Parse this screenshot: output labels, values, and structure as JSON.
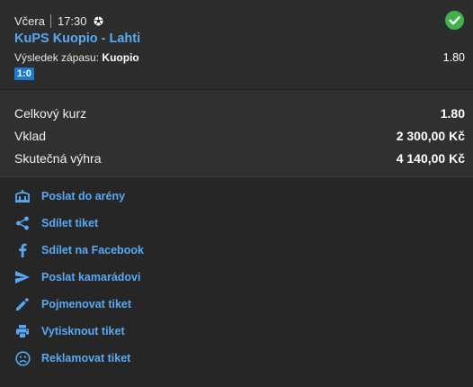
{
  "bet": {
    "day": "Včera",
    "time": "17:30",
    "sport_icon": "soccer-ball-icon",
    "status_icon": "check-circle-icon",
    "match": "KuPS Kuopio - Lahti",
    "market_label": "Výsledek zápasu:",
    "selection": "Kuopio",
    "odd": "1.80",
    "score": "1:0"
  },
  "summary": {
    "total_odds_label": "Celkový kurz",
    "total_odds_value": "1.80",
    "stake_label": "Vklad",
    "stake_value": "2 300,00 Kč",
    "win_label": "Skutečná výhra",
    "win_value": "4 140,00 Kč"
  },
  "actions": [
    {
      "label": "Poslat do arény",
      "icon": "arena-icon"
    },
    {
      "label": "Sdílet tiket",
      "icon": "share-icon"
    },
    {
      "label": "Sdílet na Facebook",
      "icon": "facebook-icon"
    },
    {
      "label": "Poslat kamarádovi",
      "icon": "send-icon"
    },
    {
      "label": "Pojmenovat tiket",
      "icon": "pencil-icon"
    },
    {
      "label": "Vytisknout tiket",
      "icon": "printer-icon"
    },
    {
      "label": "Reklamovat tiket",
      "icon": "sad-face-icon"
    }
  ],
  "colors": {
    "link": "#58a9f4",
    "success": "#3fb24a",
    "score_badge": "#1c79d6"
  }
}
